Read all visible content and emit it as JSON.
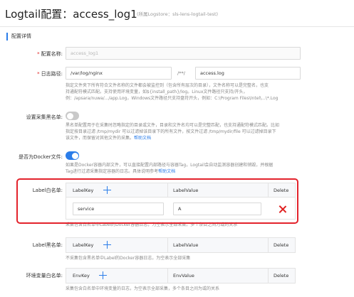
{
  "header": {
    "title": "Logtail配置：access_log1",
    "subtitle": "(所属Logstore：sls-lens-logtail-test)"
  },
  "section": {
    "title": "配置详情"
  },
  "config_name": {
    "label": "配置名称:",
    "value": "access_log1"
  },
  "log_path": {
    "label": "日志路径:",
    "dir": "/var/log/nginx",
    "sep": "/**/",
    "file": "access.log",
    "help": [
      "指定文件夹下所有符合文件名称的文件都会被监控到（包含所有层次的目录），文件名称可以是完整名，也支",
      "持通配符模式匹配。支持使用环境变量，如${install_path}/log。Linux文件路径只支持/开头，",
      "例：/apsara/nuwa/.../app.Log，Windows文件路径只支持盘符开头，例如：C:\\Program Files\\Intel\\...\\*.Log"
    ]
  },
  "blacklist": {
    "label": "设置采集黑名单:",
    "enabled": false,
    "help": [
      "黑名单配置用于在采集时忽略指定的目录或文件，目录和文件名均可以是完整匹配，也支持通配符模式匹配。比如",
      "指定按目录过滤 /tmp/mydir 可以过滤掉该目录下的所有文件，按文件过滤 /tmp/mydir/file 可以过滤掉目录下",
      "该文件，而保留对其他文件的采集。"
    ],
    "help_link": "帮助文档"
  },
  "docker": {
    "label": "是否为Docker文件:",
    "enabled": true,
    "help": [
      "如果是Docker容器内部文件，可以直接配置内部路径与容器Tag，Logtail会自动监测容器创建和销毁，并根据",
      "Tag进行过滤采集指定容器的日志。具体说明参考"
    ],
    "help_link": "帮助文档"
  },
  "label_whitelist": {
    "label": "Label白名单:",
    "columns": {
      "key": "LabelKey",
      "value": "LabelValue",
      "action": "Delete"
    },
    "rows": [
      {
        "key": "service",
        "value": "A"
      }
    ],
    "help": "采集包含白名单中Label的Docker容器日志，为空表示全部采集。多个条目之间为或的关系"
  },
  "label_blacklist": {
    "label": "Label黑名单:",
    "columns": {
      "key": "LabelKey",
      "value": "LabelValue",
      "action": "Delete"
    },
    "help": "不采集包含黑名单中Label的Docker容器日志，为空表示全部采集"
  },
  "env_whitelist": {
    "label": "环境变量白名单:",
    "columns": {
      "key": "EnvKey",
      "value": "EnvValue",
      "action": "Delete"
    },
    "help": "采集包含白名单中环境变量的日志，为空表示全部采集，多个条目之间为或的关系"
  },
  "colors": {
    "accent": "#2b7de9",
    "danger": "#e3232c"
  }
}
